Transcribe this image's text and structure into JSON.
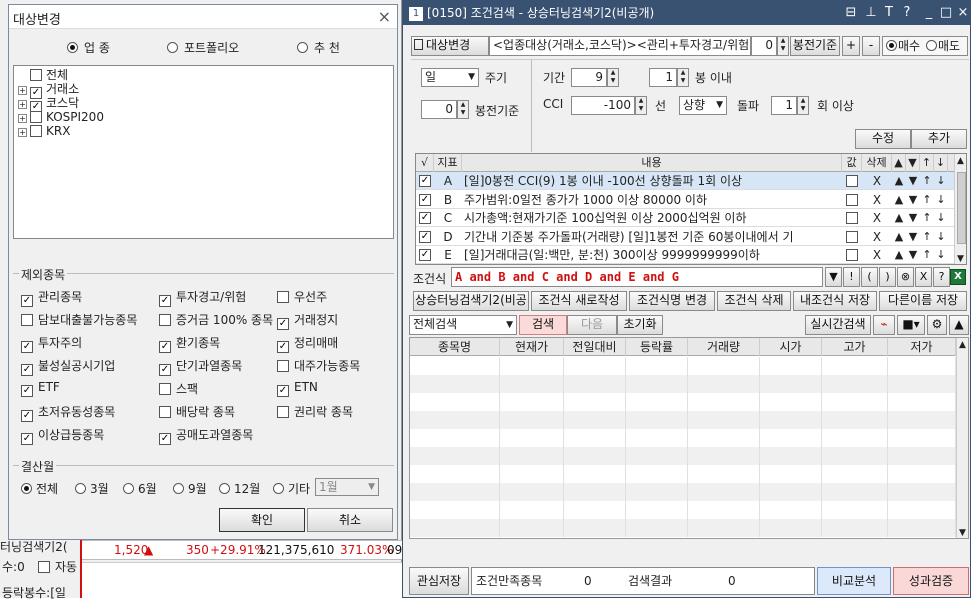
{
  "background": {
    "row_price": "1,520",
    "row_change": "350",
    "row_rate": "+29.91%",
    "row_volume": "121,375,610",
    "row_pct": "371.03%",
    "row_tail": "09",
    "left_text1": "터닝검색기2(",
    "left_text2": "수:0",
    "left_check_label": "자동",
    "left_text3": "등락봉수:[일"
  },
  "dialog": {
    "title": "대상변경",
    "close_glyph": "×",
    "radios": [
      "업 종",
      "포트폴리오",
      "추 천"
    ],
    "radio_selected": 0,
    "tree": [
      {
        "label": "전체",
        "checked": false,
        "expander": false
      },
      {
        "label": "거래소",
        "checked": true,
        "expander": true
      },
      {
        "label": "코스닥",
        "checked": true,
        "expander": true
      },
      {
        "label": "KOSPI200",
        "checked": false,
        "expander": true
      },
      {
        "label": "KRX",
        "checked": false,
        "expander": true
      }
    ],
    "exclude_title": "제외종목",
    "exclude_items": [
      {
        "label": "관리종목",
        "checked": true
      },
      {
        "label": "투자경고/위험",
        "checked": true
      },
      {
        "label": "우선주",
        "checked": false
      },
      {
        "label": "담보대출불가능종목",
        "checked": false
      },
      {
        "label": "증거금 100% 종목",
        "checked": false
      },
      {
        "label": "거래정지",
        "checked": true
      },
      {
        "label": "투자주의",
        "checked": true
      },
      {
        "label": "환기종목",
        "checked": true
      },
      {
        "label": "정리매매",
        "checked": true
      },
      {
        "label": "불성실공시기업",
        "checked": true
      },
      {
        "label": "단기과열종목",
        "checked": true
      },
      {
        "label": "대주가능종목",
        "checked": false
      },
      {
        "label": "ETF",
        "checked": true
      },
      {
        "label": "스팩",
        "checked": false
      },
      {
        "label": "ETN",
        "checked": true
      },
      {
        "label": "초저유동성종목",
        "checked": true
      },
      {
        "label": "배당락 종목",
        "checked": false
      },
      {
        "label": "권리락 종목",
        "checked": false
      },
      {
        "label": "이상급등종목",
        "checked": true
      },
      {
        "label": "공매도과열종목",
        "checked": true
      }
    ],
    "settle_title": "결산월",
    "settle_options": [
      "전체",
      "3월",
      "6월",
      "9월",
      "12월",
      "기타"
    ],
    "settle_selected": 0,
    "settle_month_value": "1월",
    "confirm_label": "확인",
    "cancel_label": "취소"
  },
  "main": {
    "title_num": "1",
    "title": "[0150] 조건검색 - 상승터닝검색기2(비공개)",
    "title_icons": [
      "⊟",
      "📌",
      "T",
      "?",
      "_",
      "□",
      "×"
    ],
    "toolbar": {
      "target_button": "대상변경",
      "target_text": "<업종대상(거래소,코스닥)><관리+투자경고/위험",
      "bar_value": "0",
      "bar_label": "봉전기준",
      "plus": "+",
      "minus": "-",
      "buy_label": "매수",
      "sell_label": "매도",
      "buy_selected": true
    },
    "cond": {
      "period_value": "일",
      "period_label": "주기",
      "bars_value": "0",
      "bars_label": "봉전기준",
      "range_label": "기간",
      "range_value": "9",
      "range_bars": "1",
      "range_bars_label": "봉 이내",
      "cci_label": "CCI",
      "cci_value": "-100",
      "line_label": "선",
      "dir_value": "상향",
      "break_label": "돌파",
      "times_value": "1",
      "times_label": "회 이상",
      "edit_button": "수정",
      "add_button": "추가"
    },
    "cond_table": {
      "headers": [
        "√",
        "지표",
        "내용",
        "값",
        "삭제",
        "▲",
        "▼",
        "↑",
        "↓"
      ],
      "rows": [
        {
          "key": "A",
          "content": "[일]0봉전 CCI(9) 1봉 이내 -100선 상향돌파 1회 이상",
          "del": "X",
          "selected": true
        },
        {
          "key": "B",
          "content": "주가범위:0일전 종가가 1000 이상 80000 이하",
          "del": "X",
          "selected": false
        },
        {
          "key": "C",
          "content": "시가총액:현재가기준 100십억원 이상 2000십억원 이하",
          "del": "X",
          "selected": false
        },
        {
          "key": "D",
          "content": "기간내 기준봉 주가돌파(거래량) [일]1봉전 기준 60봉이내에서 기",
          "del": "X",
          "selected": false
        },
        {
          "key": "E",
          "content": "[일]거래대금(일:백만, 분:천) 300이상 9999999999이하",
          "del": "X",
          "selected": false
        }
      ]
    },
    "formula": {
      "label": "조건식",
      "value": "A and B and C and D and E and G",
      "symbols": [
        "▼",
        "!",
        "(",
        ")",
        "⊗",
        "X",
        "?"
      ]
    },
    "action_buttons": [
      "상승터닝검색기2(비공",
      "조건식 새로작성",
      "조건식명 변경",
      "조건식 삭제",
      "내조건식 저장",
      "다른이름 저장"
    ],
    "search_bar": {
      "scope_value": "전체검색",
      "search_button": "검색",
      "next_button": "다음",
      "reset_button": "초기화",
      "realtime_button": "실시간검색"
    },
    "result_headers": [
      "종목명",
      "현재가",
      "전일대비",
      "등락률",
      "거래량",
      "시가",
      "고가",
      "저가"
    ],
    "bottom": {
      "save_button": "관심저장",
      "match_label": "조건만족종목",
      "match_value": "0",
      "result_label": "검색결과",
      "result_value": "0",
      "compare_button": "비교분석",
      "perf_button": "성과검증"
    }
  }
}
